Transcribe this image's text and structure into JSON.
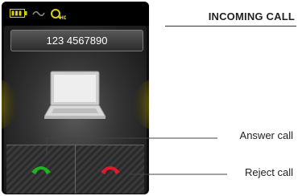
{
  "phone": {
    "status_icons": [
      "battery-icon",
      "signal-icon",
      "hd-voice-icon"
    ],
    "caller_number": "123 4567890",
    "answer_color": "#1db41d",
    "reject_color": "#e01a2a"
  },
  "annotations": {
    "title": "INCOMING CALL",
    "answer_label": "Answer call",
    "reject_label": "Reject call"
  }
}
